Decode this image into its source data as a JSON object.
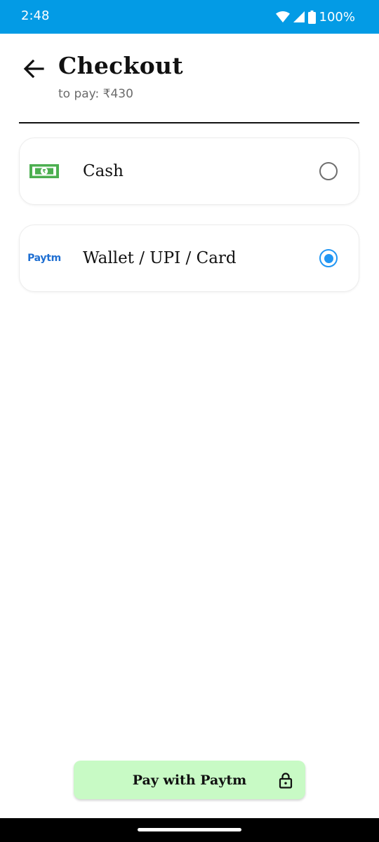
{
  "status_bar": {
    "time": "2:48",
    "battery": "100%",
    "icons": [
      "wifi-icon",
      "signal-icon",
      "battery-icon"
    ]
  },
  "header": {
    "back_icon": "arrow-back-icon",
    "title": "Checkout",
    "subtitle": "to pay: ₹430"
  },
  "payment_options": [
    {
      "icon": "cash-note-icon",
      "label": "Cash",
      "selected": false
    },
    {
      "icon": "paytm-logo",
      "logo_text": "Paytm",
      "label": "Wallet / UPI / Card",
      "selected": true
    }
  ],
  "pay_button": {
    "label": "Pay with Paytm",
    "icon": "lock-icon"
  },
  "colors": {
    "status_bar": "#039be5",
    "accent": "#2196f3",
    "pay_button_bg": "#c8fac5",
    "cash_green": "#4caf50",
    "paytm_blue": "#1f6fd2"
  }
}
